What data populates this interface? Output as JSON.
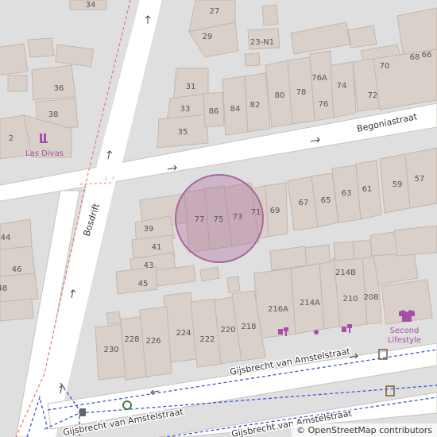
{
  "map": {
    "streets": {
      "begonia": "Begoniastraat",
      "bosdrift": "Bosdrift",
      "gijsbrecht_upper": "Gijsbrecht van Amstelstraat",
      "gijsbrecht_lower": "Gijsbrecht van Amstelstraat"
    },
    "house_numbers": [
      "34",
      "27",
      "29",
      "23-N1",
      "36",
      "38",
      "2",
      "31",
      "33",
      "35",
      "86",
      "84",
      "82",
      "80",
      "78",
      "76A",
      "76",
      "74",
      "72",
      "70",
      "68",
      "66",
      "59",
      "57",
      "67",
      "65",
      "63",
      "61",
      "39",
      "41",
      "43",
      "45",
      "77",
      "75",
      "73",
      "71",
      "69",
      "214B",
      "216A",
      "214A",
      "210",
      "208",
      "224",
      "222",
      "220",
      "218",
      "230",
      "228",
      "226",
      "44",
      "46",
      "48"
    ],
    "pois": {
      "las_divas": "Las Divas",
      "second_lifestyle_line1": "Second",
      "second_lifestyle_line2": "Lifestyle"
    },
    "highlight_color": "#a8679b"
  },
  "attribution": {
    "symbol": "©",
    "text": "OpenStreetMap contributors"
  }
}
